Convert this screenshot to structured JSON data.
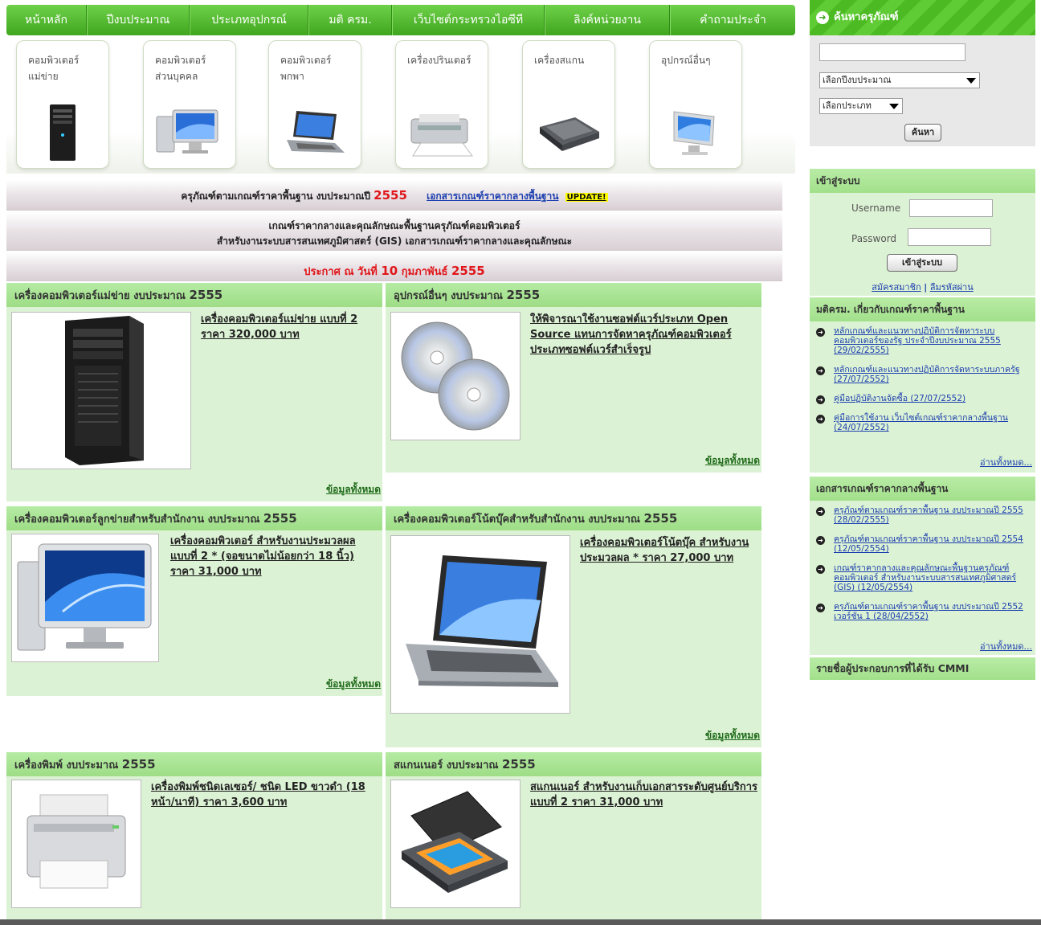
{
  "nav": {
    "items": [
      "หน้าหลัก",
      "ปีงบประมาณ",
      "ประเภทอุปกรณ์",
      "มติ ครม.",
      "เว็บไซต์กระทรวงไอซีที",
      "ลิงค์หน่วยงาน",
      "คำถามประจำ"
    ]
  },
  "categories": [
    {
      "line1": "คอมพิวเตอร์",
      "line2": "แม่ข่าย",
      "icon": "server-icon"
    },
    {
      "line1": "คอมพิวเตอร์",
      "line2": "ส่วนบุคคล",
      "icon": "desktop-icon"
    },
    {
      "line1": "คอมพิวเตอร์",
      "line2": "พกพา",
      "icon": "laptop-icon"
    },
    {
      "line1": "เครื่องปรินเตอร์",
      "line2": "",
      "icon": "printer-icon"
    },
    {
      "line1": "เครื่องสแกน",
      "line2": "",
      "icon": "scanner-icon"
    },
    {
      "line1": "อุปกรณ์อื่นๆ",
      "line2": "",
      "icon": "monitor-icon"
    }
  ],
  "banners": {
    "criteria_text": "ครุภัณฑ์ตามเกณฑ์ราคาพื้นฐาน งบประมาณปี",
    "criteria_year": "2555",
    "doc_link": "เอกสารเกณฑ์ราคากลางพื้นฐาน",
    "update_badge": "UPDATE!",
    "gis_line1": "เกณฑ์ราคากลางและคุณลักษณะพื้นฐานครุภัณฑ์คอมพิวเตอร์",
    "gis_line2": "สำหรับงานระบบสารสนเทศภูมิศาสตร์ (GIS)  เอกสารเกณฑ์ราคากลางและคุณลักษณะ",
    "announce_prefix": "ประกาศ ณ วันที่",
    "announce_day": "10",
    "announce_month": "กุมภาพันธ์",
    "announce_year": "2555"
  },
  "panels": {
    "server": {
      "title": "เครื่องคอมพิวเตอร์แม่ข่าย งบประมาณ",
      "year": "2555",
      "text": "เครื่องคอมพิวเตอร์แม่ข่าย แบบที่ 2 ราคา 320,000 บาท",
      "more": "ข้อมูลทั้งหมด"
    },
    "other": {
      "title": "อุปกรณ์อื่นๆ งบประมาณ",
      "year": "2555",
      "text": "ให้พิจารณาใช้งานซอฟต์แวร์ประเภท Open Source แทนการจัดหาครุภัณฑ์คอมพิวเตอร์ ประเภทซอฟต์แวร์สำเร็จรูป",
      "more": "ข้อมูลทั้งหมด"
    },
    "desktop": {
      "title": "เครื่องคอมพิวเตอร์ลูกข่ายสำหรับสำนักงาน งบประมาณ",
      "year": "2555",
      "text": "เครื่องคอมพิวเตอร์ สำหรับงานประมวลผล แบบที่ 2 * (จอขนาดไม่น้อยกว่า 18 นิ้ว) ราคา 31,000 บาท",
      "more": "ข้อมูลทั้งหมด"
    },
    "notebook": {
      "title": "เครื่องคอมพิวเตอร์โน้ตบุ๊คสำหรับสำนักงาน งบประมาณ",
      "year": "2555",
      "text": "เครื่องคอมพิวเตอร์โน้ตบุ๊ค สำหรับงานประมวลผล * ราคา 27,000 บาท",
      "more": "ข้อมูลทั้งหมด"
    },
    "printer": {
      "title": "เครื่องพิมพ์ งบประมาณ",
      "year": "2555",
      "text": "เครื่องพิมพ์ชนิดเลเซอร์/ ชนิด LED ขาวดำ (18 หน้า/นาที) ราคา 3,600 บาท"
    },
    "scanner": {
      "title": "สแกนเนอร์ งบประมาณ",
      "year": "2555",
      "text": "สแกนเนอร์ สำหรับงานเก็บเอกสารระดับศูนย์บริการ แบบที่ 2 ราคา 31,000 บาท"
    }
  },
  "sidebar": {
    "search": {
      "title": "ค้นหาครุภัณฑ์",
      "keyword_value": "",
      "year_select": "เลือกปีงบประมาณ",
      "type_select": "เลือกประเภท",
      "button": "ค้นหา"
    },
    "login": {
      "title": "เข้าสู่ระบบ",
      "username_label": "Username",
      "password_label": "Password",
      "button": "เข้าสู่ระบบ",
      "register": "สมัครสมาชิก",
      "separator": "|",
      "forgot": "ลืมรหัสผ่าน"
    },
    "news": {
      "title": "มติครม. เกี่ยวกับเกณฑ์ราคาพื้นฐาน",
      "items": [
        "หลักเกณฑ์และแนวทางปฏิบัติการจัดหาระบบคอมพิวเตอร์ของรัฐ ประจำปีงบประมาณ 2555 (29/02/2555)",
        "หลักเกณฑ์และแนวทางปฏิบัติการจัดหาระบบภาครัฐ (27/07/2552)",
        "คู่มือปฏิบัติงานจัดซื้อ (27/07/2552)",
        "คู่มือการใช้งาน เว็บไซต์เกณฑ์ราคากลางพื้นฐาน (24/07/2552)"
      ],
      "more": "อ่านทั้งหมด..."
    },
    "docs": {
      "title": "เอกสารเกณฑ์ราคากลางพื้นฐาน",
      "items": [
        "ครุภัณฑ์ตามเกณฑ์ราคาพื้นฐาน งบประมาณปี 2555 (28/02/2555)",
        "ครุภัณฑ์ตามเกณฑ์ราคาพื้นฐาน งบประมาณปี 2554 (12/05/2554)",
        "เกณฑ์ราคากลางและคุณลักษณะพื้นฐานครุภัณฑ์คอมพิวเตอร์ สำหรับงานระบบสารสนเทศภูมิศาสตร์ (GIS) (12/05/2554)",
        "ครุภัณฑ์ตามเกณฑ์ราคาพื้นฐาน งบประมาณปี 2552 เวอร์ชั่น 1 (28/04/2552)"
      ],
      "more": "อ่านทั้งหมด..."
    },
    "cmmi": {
      "title": "รายชื่อผู้ประกอบการที่ได้รับ CMMI"
    }
  },
  "colors": {
    "nav_green": "#3fa61e",
    "panel_bg": "#dcf2d4",
    "panel_head": "#a8e391",
    "accent_red": "#e0161a",
    "link_blue": "#1c3fb0"
  }
}
